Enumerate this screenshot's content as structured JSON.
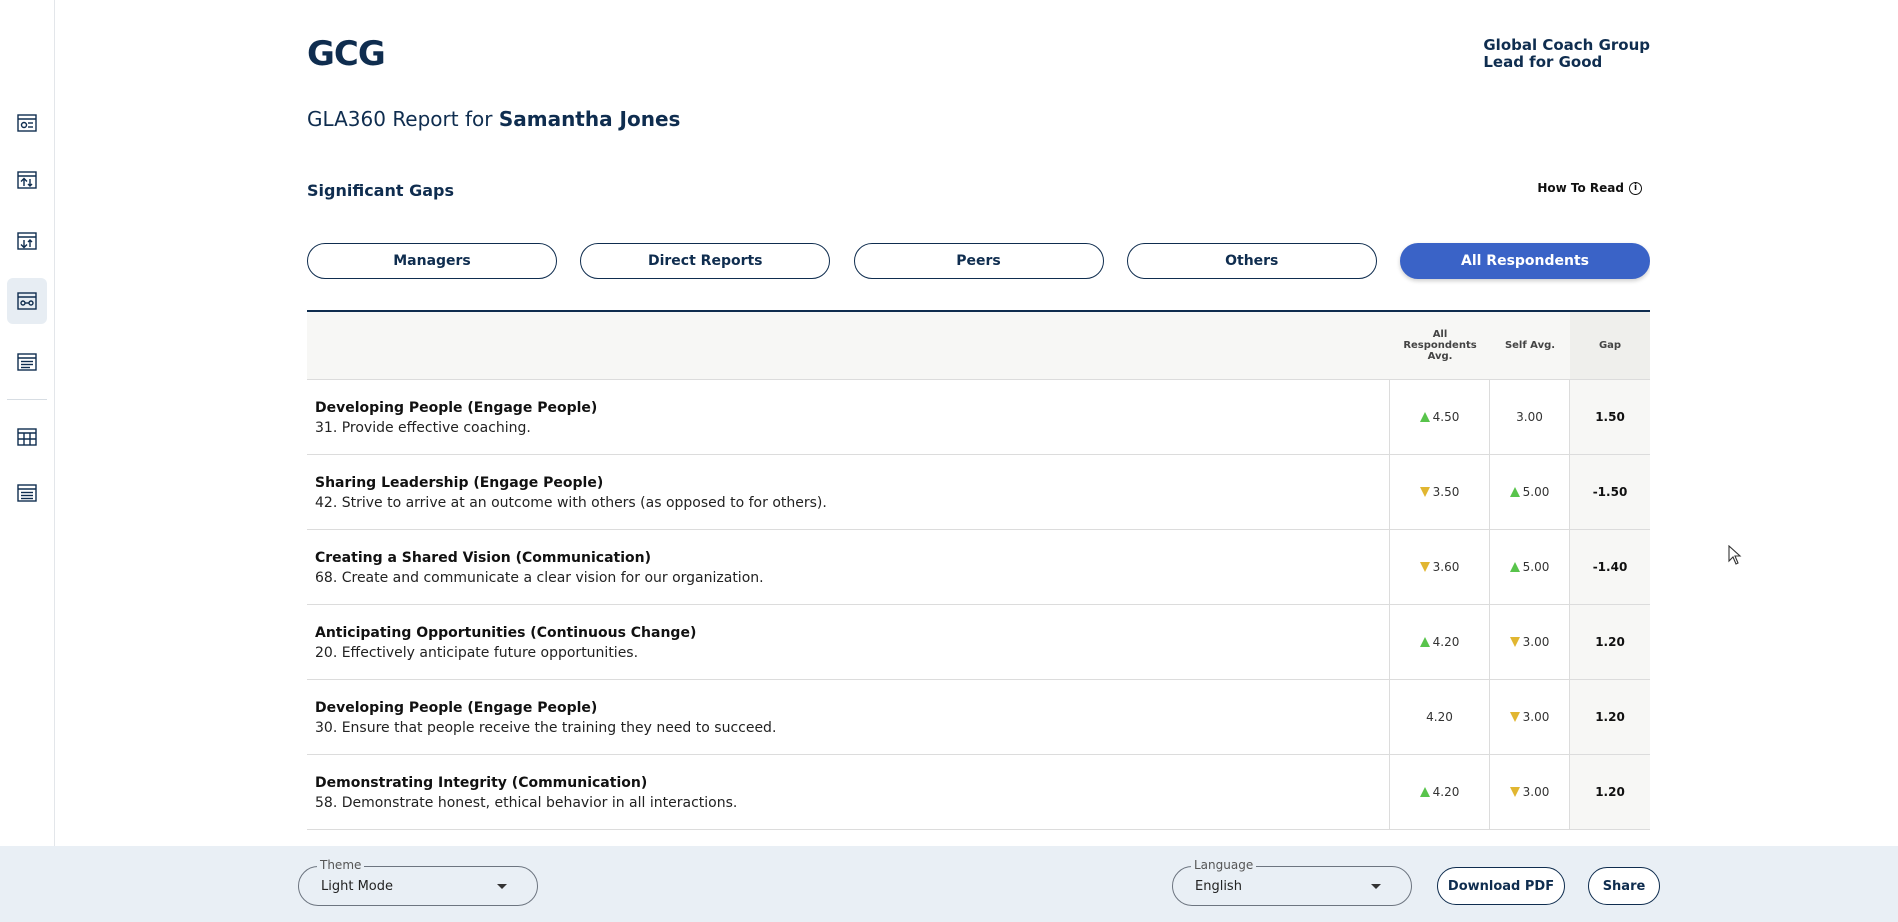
{
  "header": {
    "logo": "GCG",
    "brand_line1": "Global Coach Group",
    "brand_line2": "Lead for Good",
    "report_prefix": "GLA360 Report for",
    "person_name": "Samantha Jones"
  },
  "section": {
    "title": "Significant Gaps",
    "how_to_read": "How To Read"
  },
  "tabs": [
    {
      "label": "Managers",
      "active": false
    },
    {
      "label": "Direct Reports",
      "active": false
    },
    {
      "label": "Peers",
      "active": false
    },
    {
      "label": "Others",
      "active": false
    },
    {
      "label": "All Respondents",
      "active": true
    }
  ],
  "table": {
    "headers": {
      "all": "All Respondents Avg.",
      "self": "Self Avg.",
      "gap": "Gap"
    },
    "rows": [
      {
        "title": "Developing People (Engage People)",
        "item": "31. Provide effective coaching.",
        "all": "4.50",
        "all_trend": "up",
        "self": "3.00",
        "self_trend": "none",
        "gap": "1.50"
      },
      {
        "title": "Sharing Leadership (Engage People)",
        "item": "42. Strive to arrive at an outcome with others (as opposed to for others).",
        "all": "3.50",
        "all_trend": "down",
        "self": "5.00",
        "self_trend": "up",
        "gap": "-1.50"
      },
      {
        "title": "Creating a Shared Vision (Communication)",
        "item": "68. Create and communicate a clear vision for our organization.",
        "all": "3.60",
        "all_trend": "down",
        "self": "5.00",
        "self_trend": "up",
        "gap": "-1.40"
      },
      {
        "title": "Anticipating Opportunities (Continuous Change)",
        "item": "20. Effectively anticipate future opportunities.",
        "all": "4.20",
        "all_trend": "up",
        "self": "3.00",
        "self_trend": "down",
        "gap": "1.20"
      },
      {
        "title": "Developing People (Engage People)",
        "item": "30. Ensure that people receive the training they need to succeed.",
        "all": "4.20",
        "all_trend": "none",
        "self": "3.00",
        "self_trend": "down",
        "gap": "1.20"
      },
      {
        "title": "Demonstrating Integrity (Communication)",
        "item": "58. Demonstrate honest, ethical behavior in all interactions.",
        "all": "4.20",
        "all_trend": "up",
        "self": "3.00",
        "self_trend": "down",
        "gap": "1.20"
      }
    ]
  },
  "footer": {
    "theme_label": "Theme",
    "theme_value": "Light Mode",
    "language_label": "Language",
    "language_value": "English",
    "download_label": "Download PDF",
    "share_label": "Share"
  },
  "sidebar": {
    "icons": [
      "overview-icon",
      "strengths-icon",
      "development-icon",
      "gaps-icon",
      "comments-icon",
      "table-icon",
      "list-icon"
    ],
    "active_index": 3
  },
  "colors": {
    "primary": "#0f2d4f",
    "accent": "#3a63c7",
    "up": "#58c44b",
    "down": "#e1b631",
    "footer_bg": "#e9eff5"
  }
}
